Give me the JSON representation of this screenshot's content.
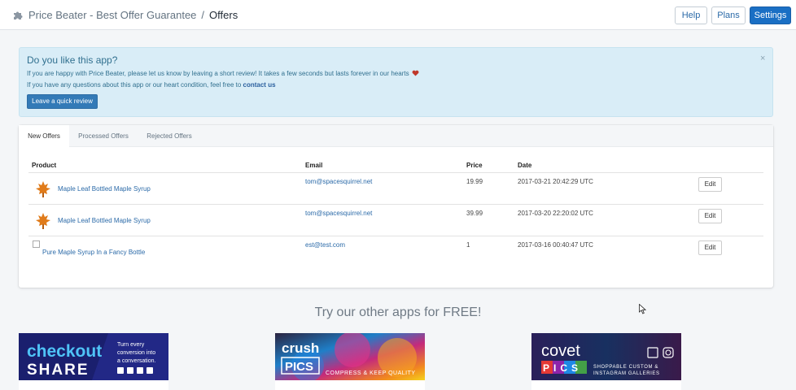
{
  "topbar": {
    "app_name": "Price Beater - Best Offer Guarantee",
    "separator": "/",
    "page": "Offers",
    "buttons": {
      "help": "Help",
      "plans": "Plans",
      "settings": "Settings"
    }
  },
  "alert": {
    "title": "Do you like this app?",
    "line1": "If you are happy with Price Beater, please let us know by leaving a short review! It takes a few seconds but lasts forever in our hearts",
    "line2_prefix": "If you have any questions about this app or our heart condition, feel free to",
    "line2_link": "contact us",
    "close": "×",
    "button": "Leave a quick review"
  },
  "tabs": [
    "New Offers",
    "Processed Offers",
    "Rejected Offers"
  ],
  "table": {
    "headers": [
      "Product",
      "Email",
      "Price",
      "Date"
    ],
    "rows": [
      {
        "product": "Maple Leaf Bottled Maple Syrup",
        "email": "tom@spacesquirrel.net",
        "price": "19.99",
        "date": "2017-03-21 20:42:29 UTC",
        "action": "Edit"
      },
      {
        "product": "Maple Leaf Bottled Maple Syrup",
        "email": "tom@spacesquirrel.net",
        "price": "39.99",
        "date": "2017-03-20 22:20:02 UTC",
        "action": "Edit"
      },
      {
        "product": "Pure Maple Syrup In a Fancy Bottle",
        "email": "est@test.com",
        "price": "1",
        "date": "2017-03-16 00:40:47 UTC",
        "action": "Edit"
      }
    ]
  },
  "promo": {
    "title": "Try our other apps for FREE!",
    "banners": [
      {
        "name_a": "checkout",
        "name_b": "SHARE",
        "tagline": [
          "Turn every",
          "conversion into",
          "a conversation."
        ]
      },
      {
        "name_a": "crush",
        "name_b": "PICS",
        "tagline": [
          "COMPRESS & KEEP QUALITY"
        ]
      },
      {
        "name_a": "covet",
        "name_b": "PICS",
        "tagline": [
          "SHOPPABLE CUSTOM &",
          "INSTAGRAM GALLERIES"
        ]
      }
    ]
  },
  "colors": {
    "primary": "#1a6fc4",
    "alert_bg": "#d9edf7",
    "alert_text": "#31708f",
    "link": "#2b6aa8",
    "page_bg": "#f4f6f8"
  }
}
